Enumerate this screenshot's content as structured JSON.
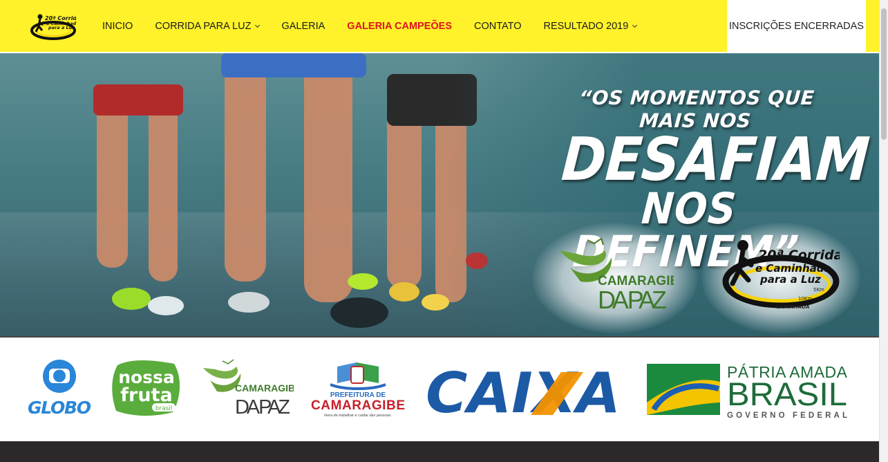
{
  "header": {
    "logo_text": [
      "20ª Corrida",
      "e Caminhada",
      "para a Luz"
    ],
    "nav": [
      {
        "label": "INICIO",
        "dropdown": false,
        "active": false
      },
      {
        "label": "CORRIDA PARA LUZ",
        "dropdown": true,
        "active": false
      },
      {
        "label": "GALERIA",
        "dropdown": false,
        "active": false
      },
      {
        "label": "GALERIA CAMPEÕES",
        "dropdown": false,
        "active": true
      },
      {
        "label": "CONTATO",
        "dropdown": false,
        "active": false
      },
      {
        "label": "RESULTADO 2019",
        "dropdown": true,
        "active": false
      }
    ],
    "cta_label": "INSCRIÇÕES ENCERRADAS"
  },
  "hero": {
    "quote_line1": "“OS MOMENTOS QUE MAIS NOS",
    "quote_line2": "DESAFIAM",
    "quote_line3": "NOS DEFINEM”",
    "logo_left": {
      "line1": "CAMARAGIBE",
      "line2": "DA PAZ"
    },
    "logo_right": {
      "line1": "20ª Corrida",
      "line2": "e Caminhada",
      "line3": "para a Luz",
      "km1": "5Km",
      "km2": "10Km",
      "tag": "CAMINHADA"
    }
  },
  "sponsors": {
    "globo": "GLOBO",
    "nossa_fruta": {
      "line1": "nossa",
      "line2": "fruta",
      "line3": "brasil"
    },
    "camaragibe_paz": {
      "line1": "CAMARAGIBE",
      "line2": "DA PAZ"
    },
    "prefeitura": {
      "line1": "PREFEITURA DE",
      "line2": "CAMARAGIBE",
      "line3": "Hora de trabalhar e cuidar das pessoas."
    },
    "caixa": "CAIXA",
    "brasil": {
      "line1": "PÁTRIA AMADA",
      "line2": "BRASIL",
      "line3": "GOVERNO FEDERAL"
    }
  },
  "colors": {
    "header_bg": "#fff22a",
    "nav_active": "#e0141e",
    "caixa_blue": "#1c5aa6",
    "caixa_orange": "#f39200",
    "brasil_green": "#1e6b3a",
    "footer_bg": "#2d292b"
  }
}
